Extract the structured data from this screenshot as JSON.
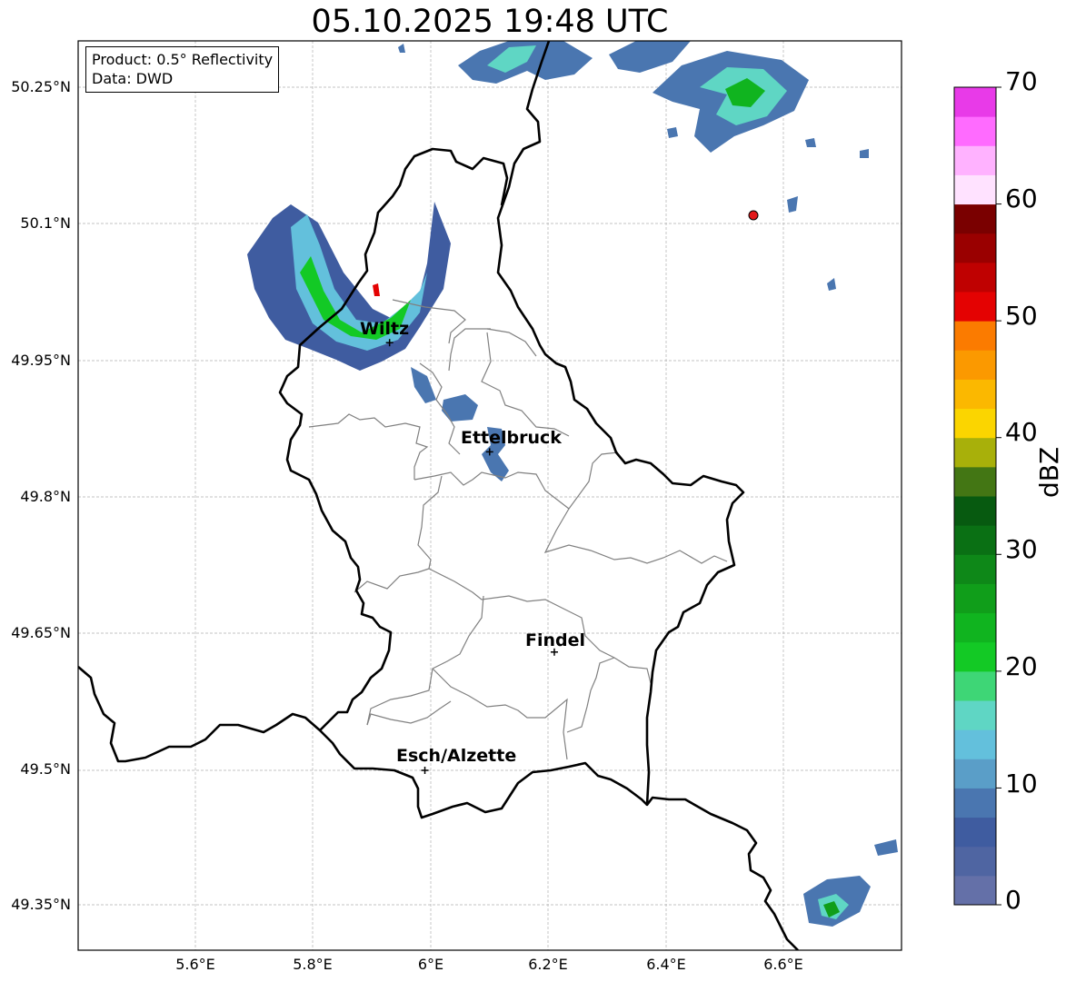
{
  "title": "05.10.2025 19:48 UTC",
  "info": {
    "product": "Product: 0.5° Reflectivity",
    "data": "Data: DWD"
  },
  "lat_ticks": [
    "50.25°N",
    "50.1°N",
    "49.95°N",
    "49.8°N",
    "49.65°N",
    "49.5°N",
    "49.35°N"
  ],
  "lon_ticks": [
    "5.6°E",
    "5.8°E",
    "6°E",
    "6.2°E",
    "6.4°E",
    "6.6°E"
  ],
  "cities": [
    {
      "name": "Wiltz",
      "lon": 5.93,
      "lat": 49.97
    },
    {
      "name": "Ettelbruck",
      "lon": 6.1,
      "lat": 49.85
    },
    {
      "name": "Findel",
      "lon": 6.21,
      "lat": 49.63
    },
    {
      "name": "Esch/Alzette",
      "lon": 5.99,
      "lat": 49.5
    }
  ],
  "radar_site": {
    "lon": 6.55,
    "lat": 50.11,
    "color": "#e31a1c"
  },
  "colorbar": {
    "label": "dBZ",
    "ticks": [
      "0",
      "10",
      "20",
      "30",
      "40",
      "50",
      "60",
      "70"
    ],
    "colors": [
      "#6470a8",
      "#4f65a2",
      "#3f5ca0",
      "#4a76b0",
      "#5a9ec8",
      "#63c0dc",
      "#5fd6c4",
      "#3ed676",
      "#13c925",
      "#10b41f",
      "#109e1a",
      "#0e8818",
      "#0a7014",
      "#075a10",
      "#437614",
      "#a8b00a",
      "#fbd500",
      "#fbb800",
      "#fb9900",
      "#fb7b00",
      "#e40202",
      "#bf0101",
      "#9a0000",
      "#7a0000",
      "#ffe2ff",
      "#ffb2ff",
      "#ff6bff",
      "#e83ae8"
    ]
  }
}
